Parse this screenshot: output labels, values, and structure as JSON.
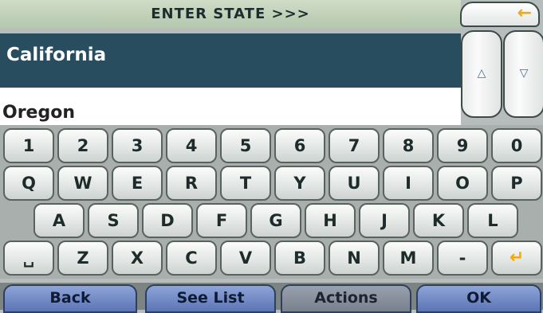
{
  "header": {
    "prompt": "ENTER STATE >>>",
    "back_icon": "arrow-left-icon",
    "back_color": "#f3a816"
  },
  "list": {
    "selected": "California",
    "next": "Oregon"
  },
  "scroll": {
    "up_icon": "△",
    "down_icon": "▽"
  },
  "keyboard": {
    "row1": [
      "1",
      "2",
      "3",
      "4",
      "5",
      "6",
      "7",
      "8",
      "9",
      "0"
    ],
    "row2": [
      "Q",
      "W",
      "E",
      "R",
      "T",
      "Y",
      "U",
      "I",
      "O",
      "P"
    ],
    "row3": [
      "A",
      "S",
      "D",
      "F",
      "G",
      "H",
      "J",
      "K",
      "L"
    ],
    "row4": [
      "␣",
      "Z",
      "X",
      "C",
      "V",
      "B",
      "N",
      "M",
      "-",
      "↵"
    ]
  },
  "buttons": {
    "back": "Back",
    "see_list": "See List",
    "actions": "Actions",
    "ok": "OK"
  }
}
